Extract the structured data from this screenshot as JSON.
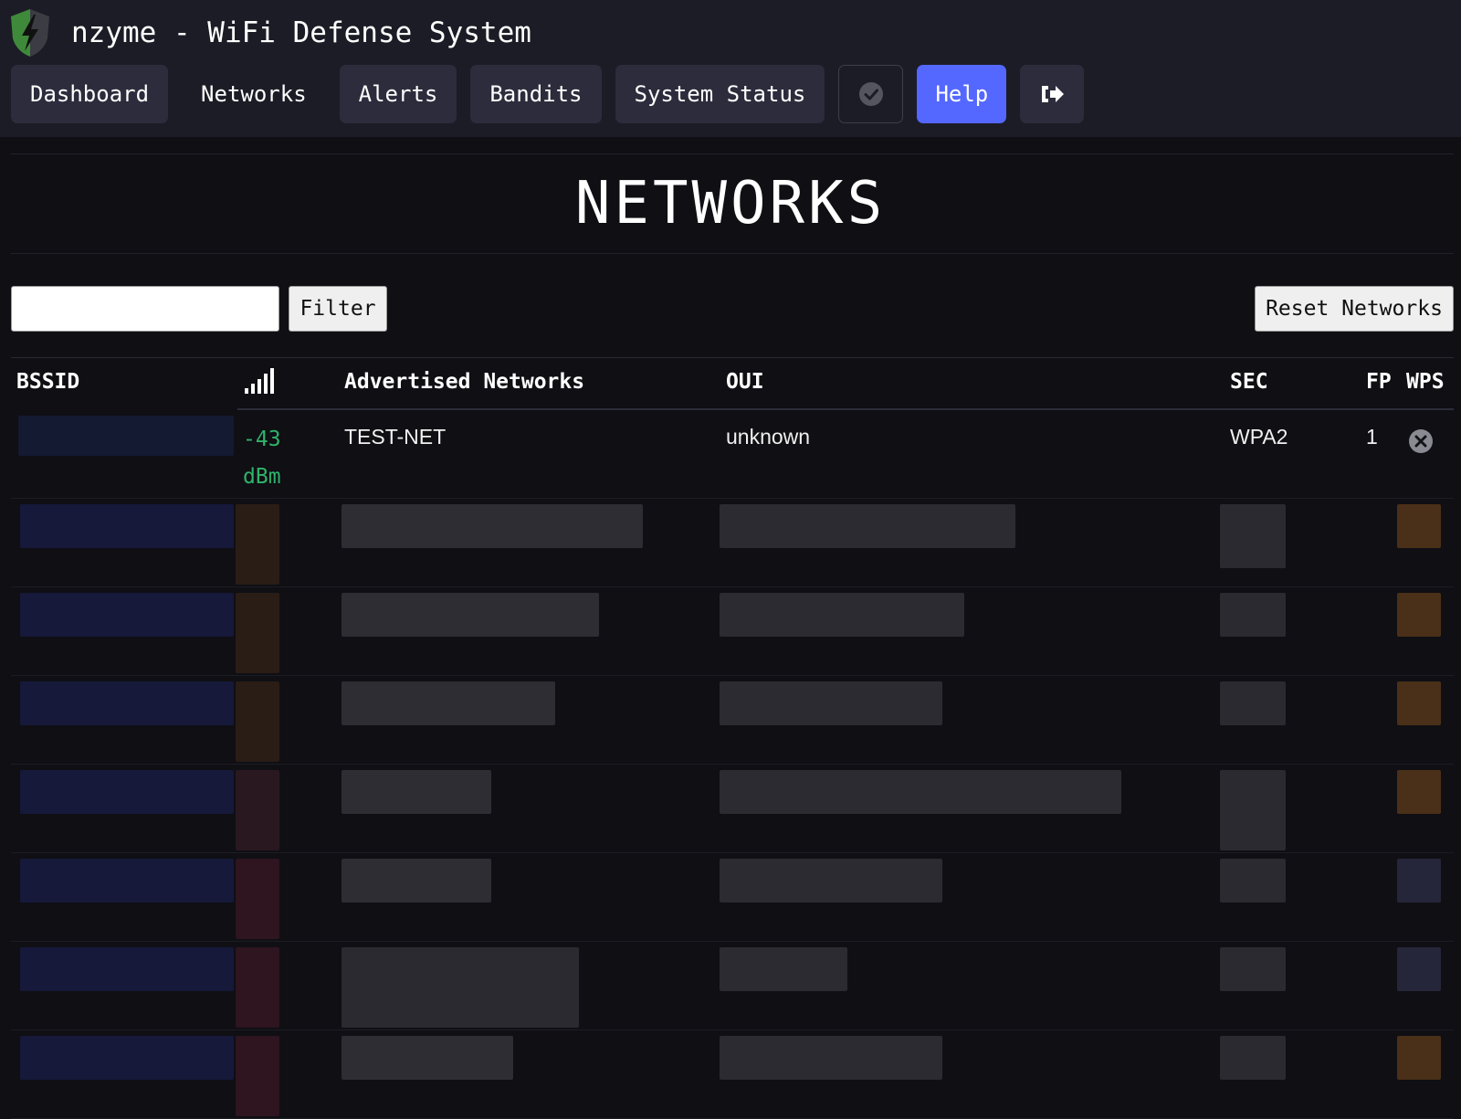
{
  "app": {
    "title": "nzyme - WiFi Defense System"
  },
  "nav": {
    "items": [
      {
        "label": "Dashboard"
      },
      {
        "label": "Networks"
      },
      {
        "label": "Alerts"
      },
      {
        "label": "Bandits"
      },
      {
        "label": "System Status"
      }
    ],
    "status_icon": "check-circle-icon",
    "help_label": "Help",
    "logout_icon": "sign-out-icon"
  },
  "page": {
    "title": "NETWORKS"
  },
  "filter": {
    "value": "",
    "button_label": "Filter"
  },
  "actions": {
    "reset_label": "Reset Networks"
  },
  "table": {
    "columns": {
      "bssid": "BSSID",
      "signal_icon": "signal-strength-icon",
      "networks": "Advertised Networks",
      "oui": "OUI",
      "sec": "SEC",
      "fp": "FP",
      "wps": "WPS"
    },
    "rows": [
      {
        "bssid": "",
        "signal_value": "-43",
        "signal_unit": "dBm",
        "network": "TEST-NET",
        "oui": "unknown",
        "sec": "WPA2",
        "fp": "1",
        "wps_icon": "x-circle-icon"
      }
    ]
  },
  "colors": {
    "background": "#0f0f14",
    "topbar": "#1c1c26",
    "button": "#2c2c3c",
    "accent": "#5468ff",
    "signal_good": "#2fb36a"
  }
}
